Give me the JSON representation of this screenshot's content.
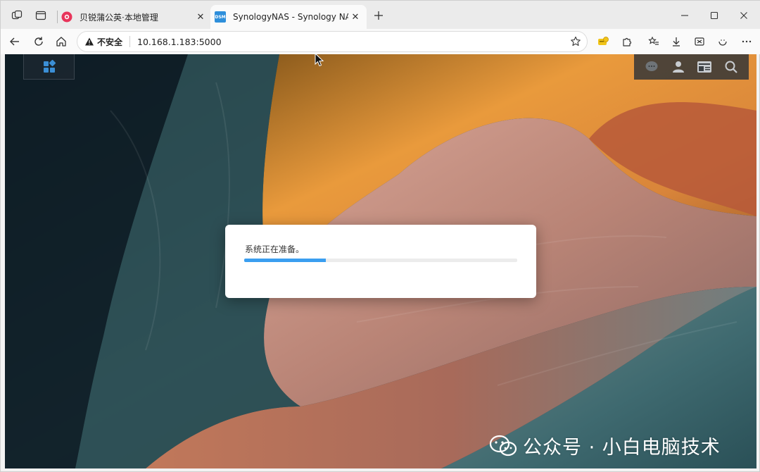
{
  "browser": {
    "tabs": [
      {
        "title": "贝锐蒲公英·本地管理",
        "active": false,
        "favicon": "pugongying-favicon"
      },
      {
        "title": "SynologyNAS - Synology NAS",
        "active": true,
        "favicon": "dsm-favicon",
        "favicon_text": "DSM"
      }
    ],
    "close_glyph": "✕",
    "address_bar": {
      "security_label": "不安全",
      "url": "10.168.1.183:5000"
    }
  },
  "dsm": {
    "main_menu_icon": "main-menu-grid-icon",
    "tray_icons": [
      "chat-icon",
      "user-icon",
      "widgets-icon",
      "search-icon"
    ],
    "loading_dialog": {
      "message": "系统正在准备。",
      "progress": 0.3
    }
  },
  "watermark": {
    "text": "公众号 · 小白电脑技术"
  },
  "colors": {
    "progress": "#3a9ef0",
    "tab_active": "#fafafa",
    "tabstrip": "#ebebeb",
    "dialog_bg": "#ffffff"
  }
}
